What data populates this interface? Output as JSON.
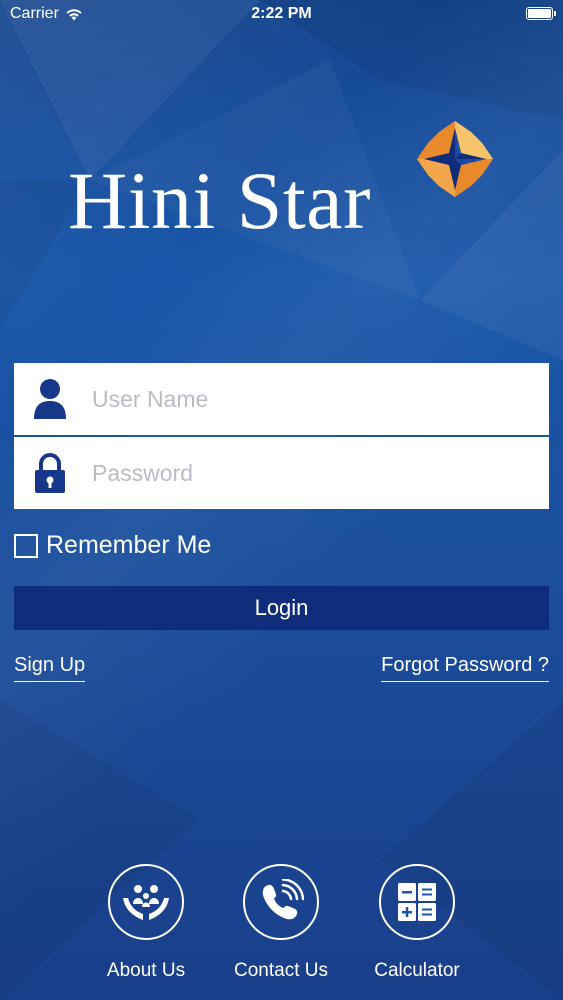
{
  "status_bar": {
    "carrier": "Carrier",
    "time": "2:22 PM",
    "wifi_icon": "wifi-icon",
    "battery_icon": "battery-icon"
  },
  "logo": {
    "text": "Hini Star",
    "star_icon": "four-point-star-icon",
    "star_colors": [
      "#f7c36a",
      "#e8892b",
      "#0f2d7a"
    ]
  },
  "login_form": {
    "username": {
      "placeholder": "User Name",
      "value": "",
      "icon": "user-icon"
    },
    "password": {
      "placeholder": "Password",
      "value": "",
      "icon": "lock-icon"
    },
    "remember_me": {
      "label": "Remember Me",
      "checked": false
    },
    "login_label": "Login"
  },
  "links": {
    "sign_up": "Sign Up",
    "forgot_password": "Forgot Password ?"
  },
  "bottom_nav": [
    {
      "label": "About Us",
      "icon": "family-care-hands-icon"
    },
    {
      "label": "Contact Us",
      "icon": "phone-ringing-icon"
    },
    {
      "label": "Calculator",
      "icon": "calculator-icon"
    }
  ],
  "colors": {
    "background": "#1a57aa",
    "login_button": "#0f2d7a",
    "field_icon": "#17378a",
    "placeholder": "#b9bcc4"
  }
}
